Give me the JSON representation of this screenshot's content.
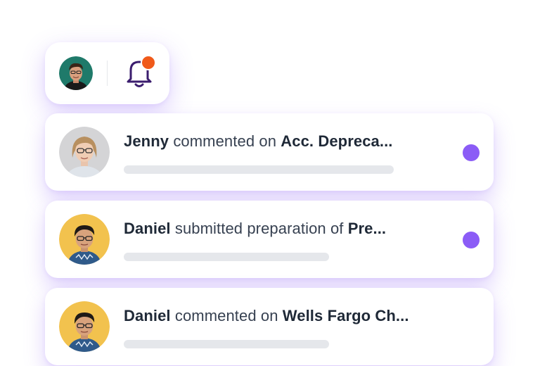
{
  "header": {
    "user_avatar_icon": "user-avatar",
    "bell_icon": "bell-icon",
    "bell_badge_color": "#f05a1a"
  },
  "notifications": [
    {
      "actor": "Jenny",
      "action": "commented on",
      "target": "Acc. Depreca...",
      "unread": true
    },
    {
      "actor": "Daniel",
      "action": "submitted preparation of",
      "target": "Pre...",
      "unread": true
    },
    {
      "actor": "Daniel",
      "action": "commented on",
      "target": "Wells Fargo Ch...",
      "unread": false
    }
  ],
  "colors": {
    "accent": "#8b5cf6",
    "text": "#374151",
    "placeholder_bar": "#e5e7eb"
  }
}
